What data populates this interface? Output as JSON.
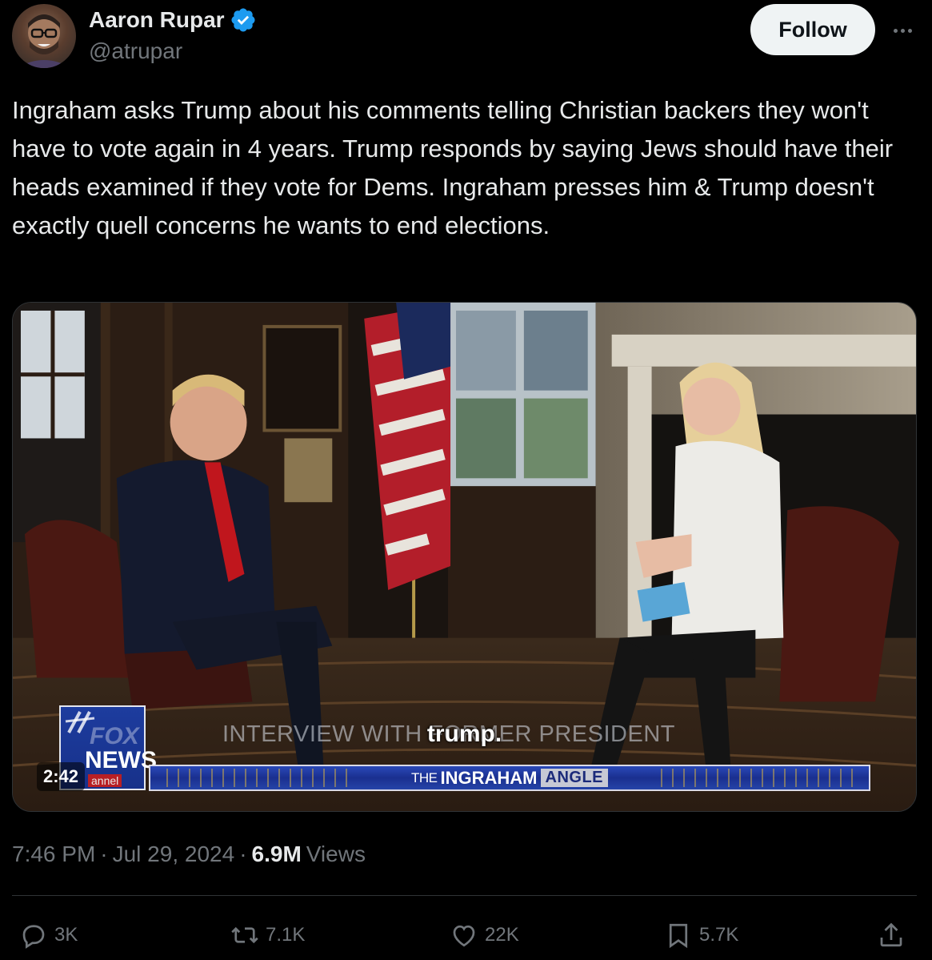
{
  "author": {
    "display_name": "Aaron Rupar",
    "handle": "@atrupar",
    "verified": true
  },
  "follow_label": "Follow",
  "tweet_text": "Ingraham asks Trump about his comments telling Christian backers they won't have to vote again in 4 years. Trump responds by saying Jews should have their heads examined if they vote for Dems. Ingraham presses him & Trump doesn't exactly quell concerns he wants to end elections.",
  "media": {
    "duration": "2:42",
    "subtitle": "trump.",
    "lower_third": "INTERVIEW WITH FORMER PRESIDENT",
    "show_title_the": "THE",
    "show_title_main": "INGRAHAM",
    "show_title_angle": "ANGLE",
    "logo_fox": "FOX",
    "logo_news": "NEWS",
    "logo_channel": "annel"
  },
  "meta": {
    "time": "7:46 PM",
    "separator": "·",
    "date": "Jul 29, 2024",
    "views_count": "6.9M",
    "views_label": "Views"
  },
  "actions": {
    "replies": "3K",
    "reposts": "7.1K",
    "likes": "22K",
    "bookmarks": "5.7K"
  },
  "colors": {
    "background": "#000000",
    "text_primary": "#e7e9ea",
    "text_secondary": "#71767b",
    "verified_badge": "#1d9bf0",
    "follow_button_bg": "#eff3f4",
    "divider": "#2f3336"
  },
  "icons": [
    "verified-badge-icon",
    "more-options-icon",
    "reply-icon",
    "repost-icon",
    "like-icon",
    "bookmark-icon",
    "share-icon"
  ]
}
